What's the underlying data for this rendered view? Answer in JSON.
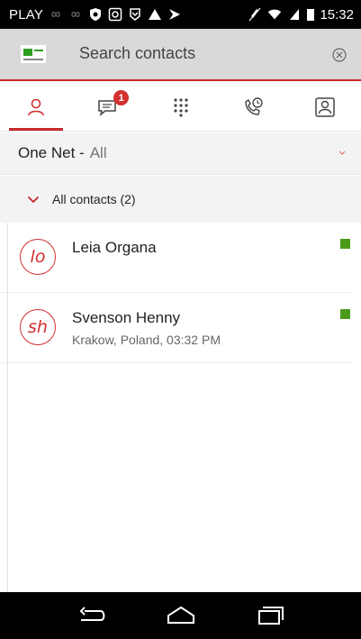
{
  "status_bar": {
    "carrier": "PLAY",
    "time": "15:32"
  },
  "search": {
    "placeholder": "Search contacts"
  },
  "tabs": [
    {
      "name": "contacts",
      "icon": "person-icon",
      "active": true
    },
    {
      "name": "messages",
      "icon": "chat-icon",
      "badge": "1"
    },
    {
      "name": "dialpad",
      "icon": "dialpad-icon"
    },
    {
      "name": "call-history",
      "icon": "phone-clock-icon"
    },
    {
      "name": "profile",
      "icon": "contact-card-icon"
    }
  ],
  "filter": {
    "prefix": "One Net -",
    "value": "All"
  },
  "group": {
    "label": "All contacts (2)"
  },
  "contacts": [
    {
      "initials": "lo",
      "name": "Leia Organa",
      "subtitle": "",
      "status_color": "#4c9a1a"
    },
    {
      "initials": "sh",
      "name": "Svenson Henny",
      "subtitle": "Krakow, Poland, 03:32 PM",
      "status_color": "#4c9a1a"
    }
  ],
  "colors": {
    "accent": "#c62828",
    "presence": "#4c9a1a",
    "logo_green": "#2e9e1f"
  }
}
